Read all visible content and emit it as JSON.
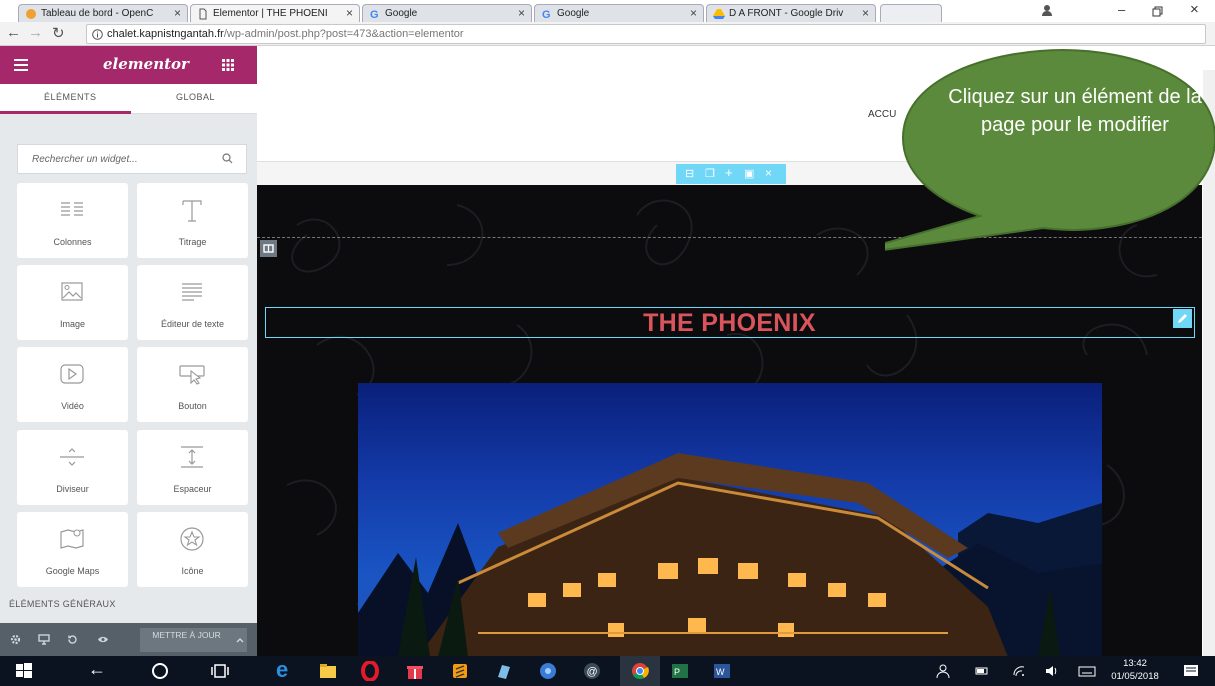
{
  "browser": {
    "tabs": [
      {
        "label": "Tableau de bord - OpenC",
        "active": false
      },
      {
        "label": "Elementor | THE PHOENI",
        "active": true
      },
      {
        "label": "Google",
        "active": false
      },
      {
        "label": "Google",
        "active": false
      },
      {
        "label": "D A FRONT - Google Driv",
        "active": false
      }
    ],
    "url_domain": "chalet.kapnistngantah.fr",
    "url_path": "/wp-admin/post.php?post=473&action=elementor"
  },
  "panel": {
    "brand": "elementor",
    "tabs": [
      "ÉLÉMENTS",
      "GLOBAL"
    ],
    "active_tab": "ÉLÉMENTS",
    "search_placeholder": "Rechercher un widget...",
    "widgets": [
      {
        "label": "Colonnes",
        "icon": "columns-icon"
      },
      {
        "label": "Titrage",
        "icon": "heading-icon"
      },
      {
        "label": "Image",
        "icon": "image-icon"
      },
      {
        "label": "Éditeur de texte",
        "icon": "text-editor-icon"
      },
      {
        "label": "Vidéo",
        "icon": "video-icon"
      },
      {
        "label": "Bouton",
        "icon": "button-icon"
      },
      {
        "label": "Diviseur",
        "icon": "divider-icon"
      },
      {
        "label": "Espaceur",
        "icon": "spacer-icon"
      },
      {
        "label": "Google Maps",
        "icon": "map-icon"
      },
      {
        "label": "Icône",
        "icon": "star-icon"
      }
    ],
    "section_label": "ÉLÉMENTS GÉNÉRAUX",
    "update_button": "METTRE À JOUR"
  },
  "canvas": {
    "nav_item": "ACCU",
    "heading": "THE PHOENIX"
  },
  "callout": {
    "text": "Cliquez sur un élément de la page pour le modifier",
    "color": "#5b8a3c"
  },
  "taskbar": {
    "time": "13:42",
    "date": "01/05/2018"
  },
  "colors": {
    "elementor_brand": "#a4286a",
    "selection": "#71d7f7",
    "heading": "#d9545b"
  }
}
